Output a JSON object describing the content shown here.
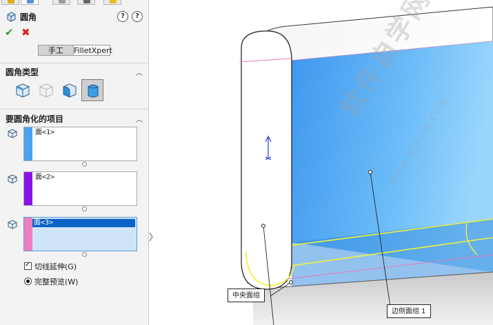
{
  "feature": {
    "title": "圆角",
    "help_glyph": "?",
    "ok_glyph": "✔",
    "cancel_glyph": "✖"
  },
  "modes": {
    "manual": "手工",
    "filletxpert": "FilletXpert"
  },
  "fillet_type": {
    "header": "圆角类型",
    "options": [
      "constant-size-fillet",
      "variable-size-fillet",
      "face-fillet",
      "full-round-fillet"
    ],
    "selected_index": 3
  },
  "items": {
    "header": "要圆角化的项目",
    "lists": [
      {
        "label": "面<1>",
        "color": "#4aa3ee"
      },
      {
        "label": "面<2>",
        "color": "#8a12e8"
      },
      {
        "label": "面<3>",
        "color": "#ef7fc0"
      }
    ],
    "active_list": 2
  },
  "options": {
    "tangent_propagation": "切线延伸(G)",
    "full_preview": "完整预览(W)"
  },
  "callouts": {
    "center_face_set": "中央面组",
    "side_face_set": "边侧面组 1"
  },
  "watermark": {
    "main": "软件自学网",
    "sub": "WWW.RJZXW.COM"
  },
  "colors": {
    "face1": "#4aa3ee",
    "face2": "#8a12e8",
    "face3": "#ef7fc0",
    "preview": "#f2f23a",
    "selected": "#0a64c8"
  }
}
